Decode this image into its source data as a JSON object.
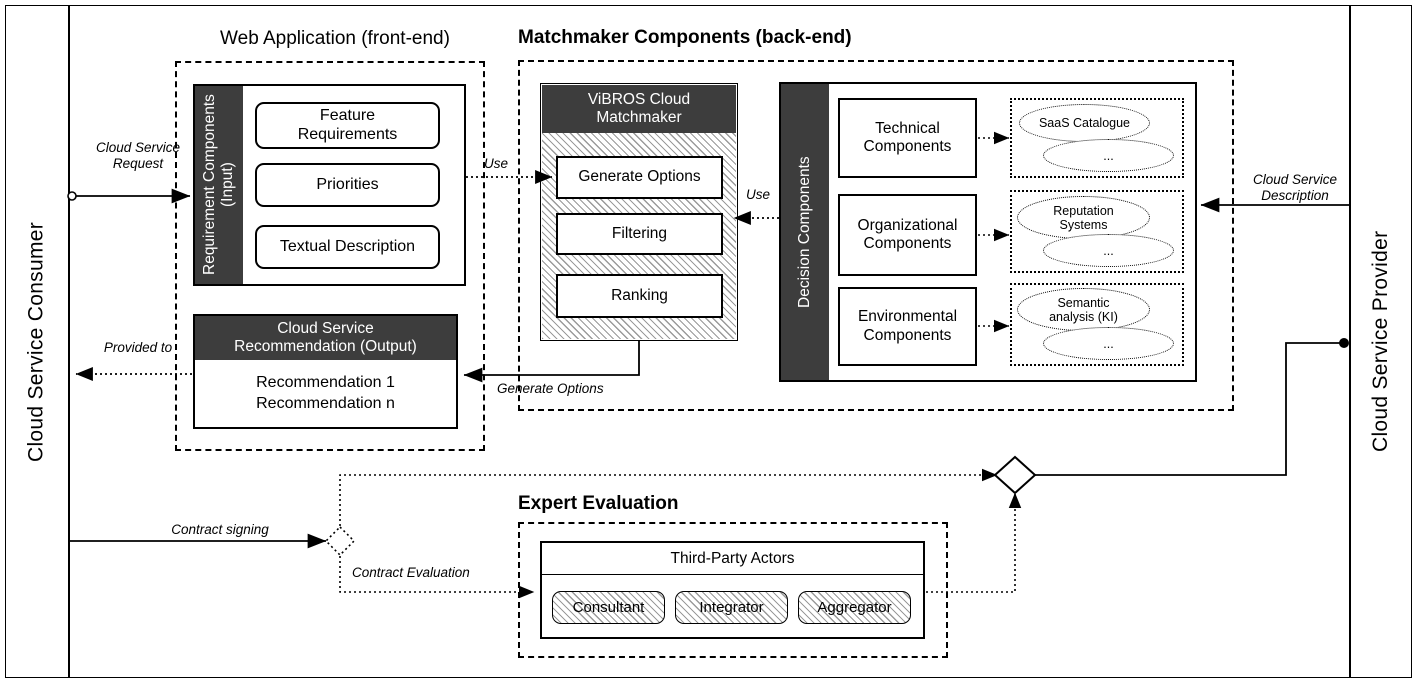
{
  "diagram": {
    "lanes": {
      "left": "Cloud Service Consumer",
      "right": "Cloud Service Provider"
    },
    "regions": {
      "web_app": "Web Application (front-end)",
      "matchmaker": "Matchmaker Components (back-end)",
      "expert": "Expert Evaluation"
    },
    "web_app": {
      "input_label": "Requirement\nComponents (Input)",
      "input_items": [
        "Feature\nRequirements",
        "Priorities",
        "Textual Description"
      ],
      "output_header": "Cloud Service\nRecommendation (Output)",
      "output_items": "Recommendation 1\nRecommendation n"
    },
    "matchmaker": {
      "header": "ViBROS Cloud\nMatchmaker",
      "steps": [
        "Generate Options",
        "Filtering",
        "Ranking"
      ]
    },
    "decision": {
      "side_label": "Decision Components",
      "rows": [
        {
          "name": "Technical\nComponents",
          "source": "SaaS Catalogue",
          "more": "..."
        },
        {
          "name": "Organizational\nComponents",
          "source": "Reputation\nSystems",
          "more": "..."
        },
        {
          "name": "Environmental\nComponents",
          "source": "Semantic\nanalysis (KI)",
          "more": "..."
        }
      ]
    },
    "expert": {
      "header": "Third-Party Actors",
      "actors": [
        "Consultant",
        "Integrator",
        "Aggregator"
      ]
    },
    "edges": {
      "cloud_service_request": "Cloud Service\nRequest",
      "provided_to": "Provided to",
      "use_left": "Use",
      "use_right": "Use",
      "generate_options": "Generate Options",
      "cloud_service_description": "Cloud Service\nDescription",
      "contract_signing": "Contract signing",
      "contract_evaluation": "Contract Evaluation"
    },
    "colors": {
      "dark_bar": "#3d3d3d",
      "line": "#000000",
      "hatch": "#9a9a9a",
      "background": "#ffffff"
    }
  }
}
